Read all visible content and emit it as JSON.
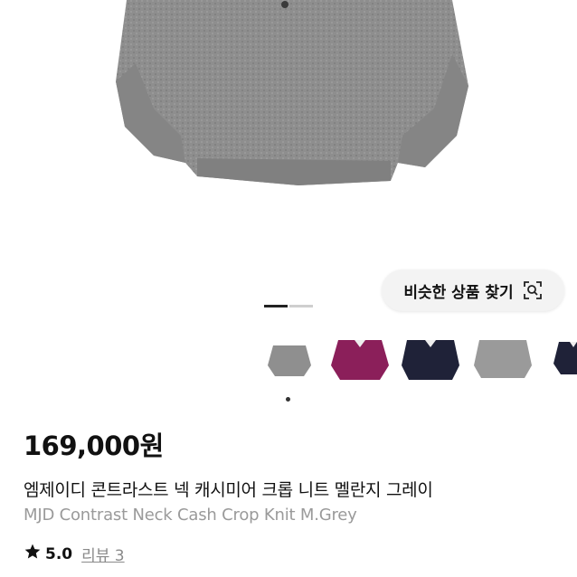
{
  "similar_search": {
    "label": "비슷한 상품 찾기",
    "icon": "camera-search-icon"
  },
  "gallery": {
    "pages": 2,
    "current_page": 1,
    "thumbnail_colors": [
      "#8f8f8f",
      "#8b1f5a",
      "#1f2238",
      "#9a9a9a",
      "#1f2238"
    ]
  },
  "product": {
    "price": "169,000원",
    "title_ko": "엠제이디 콘트라스트 넥 캐시미어 크롭 니트 멜란지 그레이",
    "title_en": "MJD Contrast Neck Cash Crop Knit M.Grey",
    "rating": "5.0",
    "reviews_label": "리뷰 3"
  }
}
